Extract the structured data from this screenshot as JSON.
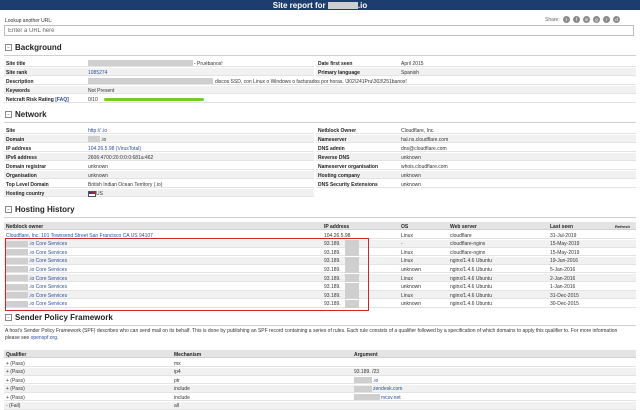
{
  "header": {
    "title_prefix": "Site report for",
    "title_suffix": ".io"
  },
  "lookup": {
    "label": "Lookup another URL:",
    "placeholder": "Enter a URL here"
  },
  "share": {
    "label": "Share:",
    "icons": [
      "twitter-icon",
      "facebook-icon",
      "linkedin-icon",
      "google-plus-icon",
      "reddit-icon",
      "digg-icon"
    ]
  },
  "background": {
    "heading": "Background",
    "left": [
      {
        "label": "Site title",
        "value": "- Pruébanos!"
      },
      {
        "label": "Site rank",
        "value": "1085274"
      },
      {
        "label": "Description",
        "value": "discos SSD, con Linux o Windows o facturados por horas. \\302\\241Pru\\303\\251banos!"
      },
      {
        "label": "Keywords",
        "value": "Not Present"
      },
      {
        "label": "Netcraft Risk Rating",
        "link": "[FAQ]",
        "value": "0/10"
      }
    ],
    "right": [
      {
        "label": "Date first seen",
        "value": "April 2015"
      },
      {
        "label": "Primary language",
        "value": "Spanish"
      }
    ],
    "risk": 0
  },
  "network": {
    "heading": "Network",
    "left": [
      {
        "label": "Site",
        "value": "http://         .io"
      },
      {
        "label": "Domain",
        "value": ".io"
      },
      {
        "label": "IP address",
        "value": "104.26.5.98 (VirusTotal)"
      },
      {
        "label": "IPv6 address",
        "value": "2606:4700:20:0:0:0:681a:462"
      },
      {
        "label": "Domain registrar",
        "value": "unknown"
      },
      {
        "label": "Organisation",
        "value": "unknown"
      },
      {
        "label": "Top Level Domain",
        "value": "British Indian Ocean Territory (.io)"
      },
      {
        "label": "Hosting country",
        "value": "US"
      }
    ],
    "right": [
      {
        "label": "Netblock Owner",
        "value": "Cloudflare, Inc."
      },
      {
        "label": "Nameserver",
        "value": "hal.ns.cloudflare.com"
      },
      {
        "label": "DNS admin",
        "value": "dns@cloudflare.com"
      },
      {
        "label": "Reverse DNS",
        "value": "unknown"
      },
      {
        "label": "Nameserver organisation",
        "value": "whois.cloudflare.com"
      },
      {
        "label": "Hosting company",
        "value": "unknown"
      },
      {
        "label": "DNS Security Extensions",
        "value": "unknown"
      }
    ]
  },
  "hosting": {
    "heading": "Hosting History",
    "columns": [
      "Netblock owner",
      "IP address",
      "OS",
      "Web server",
      "Last seen"
    ],
    "refresh": "Refresh",
    "rows": [
      {
        "owner": "Cloudflare, Inc. 101 Townsend Street San Francisco CA US 94107",
        "ip": "104.26.5.98",
        "os": "Linux",
        "server": "cloudflare",
        "seen": "31-Jul-2019"
      },
      {
        "owner": ".io Core Services",
        "ip": "93.189.",
        "os": "-",
        "server": "cloudflare-nginx",
        "seen": "15-May-2019"
      },
      {
        "owner": ".io Core Services",
        "ip": "93.189.",
        "os": "Linux",
        "server": "cloudflare-nginx",
        "seen": "15-May-2019"
      },
      {
        "owner": ".io Core Services",
        "ip": "93.189.",
        "os": "Linux",
        "server": "nginx/1.4.6 Ubuntu",
        "seen": "19-Jun-2016"
      },
      {
        "owner": ".io Core Services",
        "ip": "93.189.",
        "os": "unknown",
        "server": "nginx/1.4.6 Ubuntu",
        "seen": "5-Jan-2016"
      },
      {
        "owner": ".io Core Services",
        "ip": "93.189.",
        "os": "Linux",
        "server": "nginx/1.4.6 Ubuntu",
        "seen": "2-Jan-2016"
      },
      {
        "owner": ".io Core Services",
        "ip": "93.189.",
        "os": "unknown",
        "server": "nginx/1.4.6 Ubuntu",
        "seen": "1-Jan-2016"
      },
      {
        "owner": ".io Core Services",
        "ip": "93.189.",
        "os": "Linux",
        "server": "nginx/1.4.6 Ubuntu",
        "seen": "31-Dec-2015"
      },
      {
        "owner": ".io Core Services",
        "ip": "93.189.",
        "os": "unknown",
        "server": "nginx/1.4.6 Ubuntu",
        "seen": "30-Dec-2015"
      }
    ]
  },
  "spf": {
    "heading": "Sender Policy Framework",
    "text": "A host's Sender Policy Framework (SPF) describes who can send mail on its behalf. This is done by publishing an SPF record containing a series of rules. Each rule consists of a qualifier followed by a specification of which domains to apply this qualifier to. For more information please see",
    "link": "openspf.org.",
    "columns": [
      "Qualifier",
      "Mechanism",
      "Argument"
    ],
    "rows": [
      {
        "q": "+ (Pass)",
        "m": "mx",
        "a": ""
      },
      {
        "q": "+ (Pass)",
        "m": "ip4",
        "a": "93.189.       /23"
      },
      {
        "q": "+ (Pass)",
        "m": "ptr",
        "a": ".io"
      },
      {
        "q": "+ (Pass)",
        "m": "include",
        "a": "zendesk.com"
      },
      {
        "q": "+ (Pass)",
        "m": "include",
        "a": "mcsv.net"
      },
      {
        "q": "- (Fail)",
        "m": "all",
        "a": ""
      }
    ]
  }
}
